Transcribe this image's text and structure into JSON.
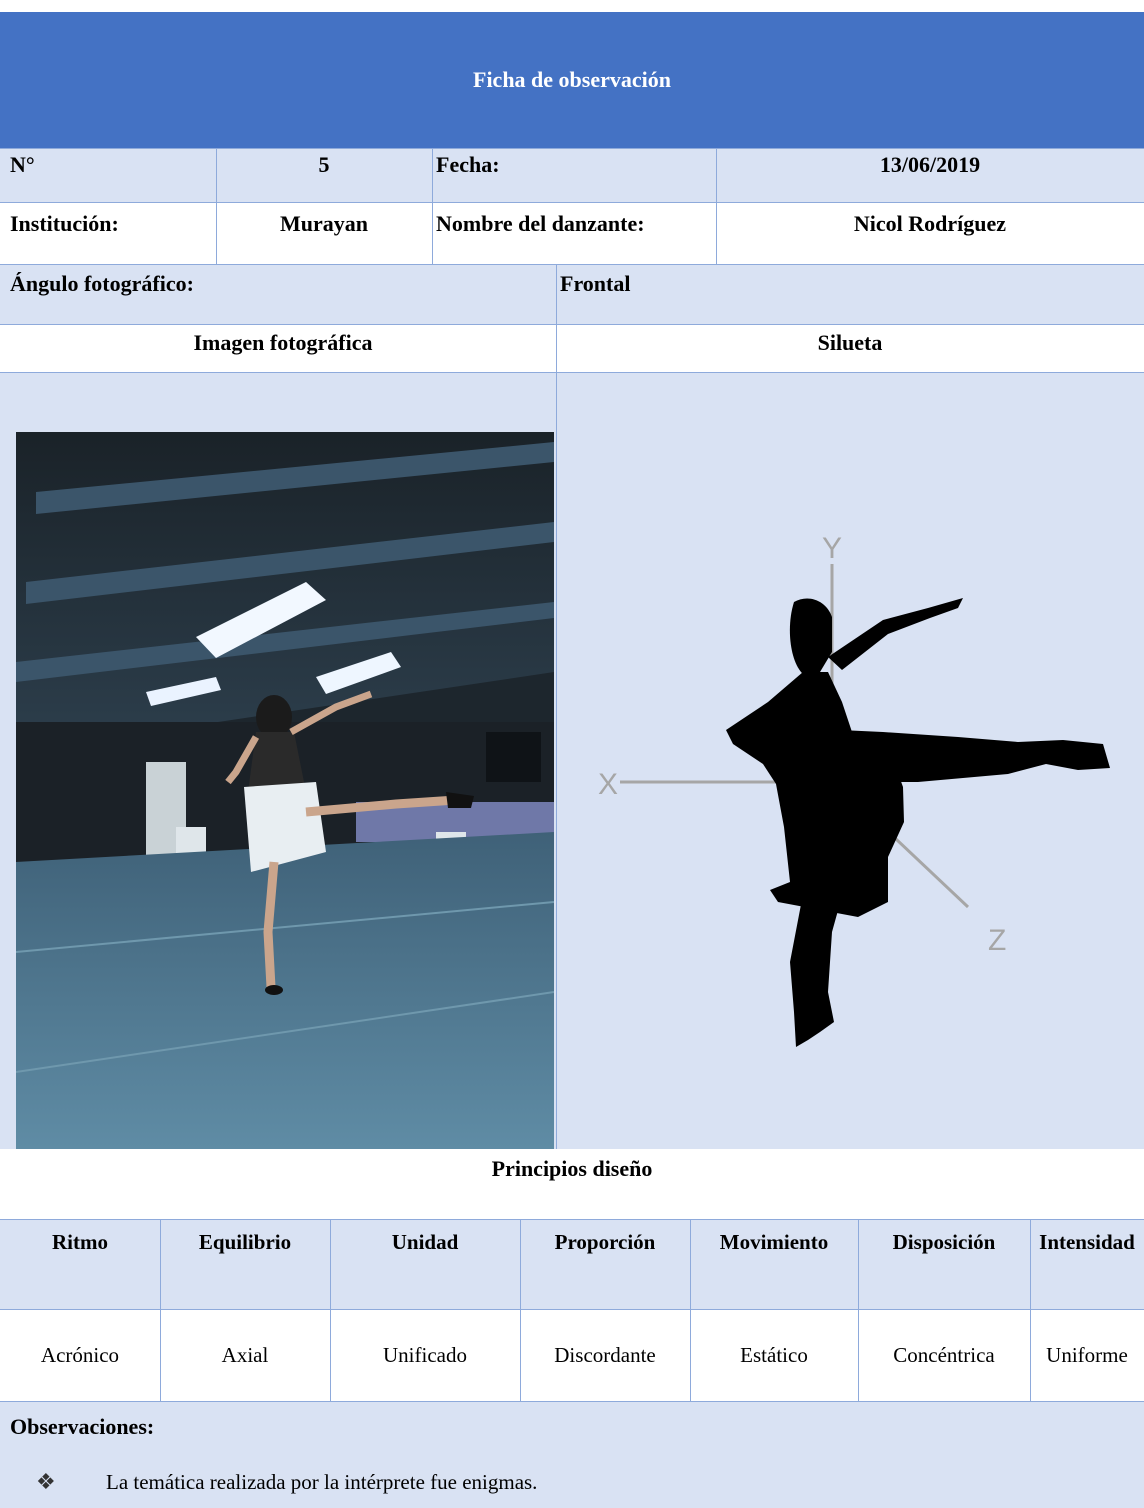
{
  "form": {
    "title": "Ficha de observación",
    "numero_label": "N°",
    "numero_value": "5",
    "fecha_label": "Fecha:",
    "fecha_value": "13/06/2019",
    "institucion_label": "Institución:",
    "institucion_value": "Murayan",
    "danzante_label": "Nombre del danzante:",
    "danzante_value": "Nicol Rodríguez",
    "angulo_label": "Ángulo fotográfico:",
    "angulo_value": "Frontal",
    "imagen_header": "Imagen fotográfica",
    "silueta_header": "Silueta"
  },
  "axes": {
    "y": "Y",
    "x": "X",
    "z": "Z"
  },
  "principios": {
    "title": "Principios diseño",
    "headers": [
      "Ritmo",
      "Equilibrio",
      "Unidad",
      "Proporción",
      "Movimiento",
      "Disposición",
      "Intensidad"
    ],
    "values": [
      "Acrónico",
      "Axial",
      "Unificado",
      "Discordante",
      "Estático",
      "Concéntrica",
      "Uniforme"
    ]
  },
  "observaciones": {
    "label": "Observaciones:",
    "items": [
      "La temática realizada por la intérprete fue enigmas."
    ],
    "bullet_icon": "diamond-bullet-icon"
  },
  "colors": {
    "header_bg": "#4472c4",
    "light_bg": "#d9e2f3",
    "border": "#8eaadb"
  }
}
